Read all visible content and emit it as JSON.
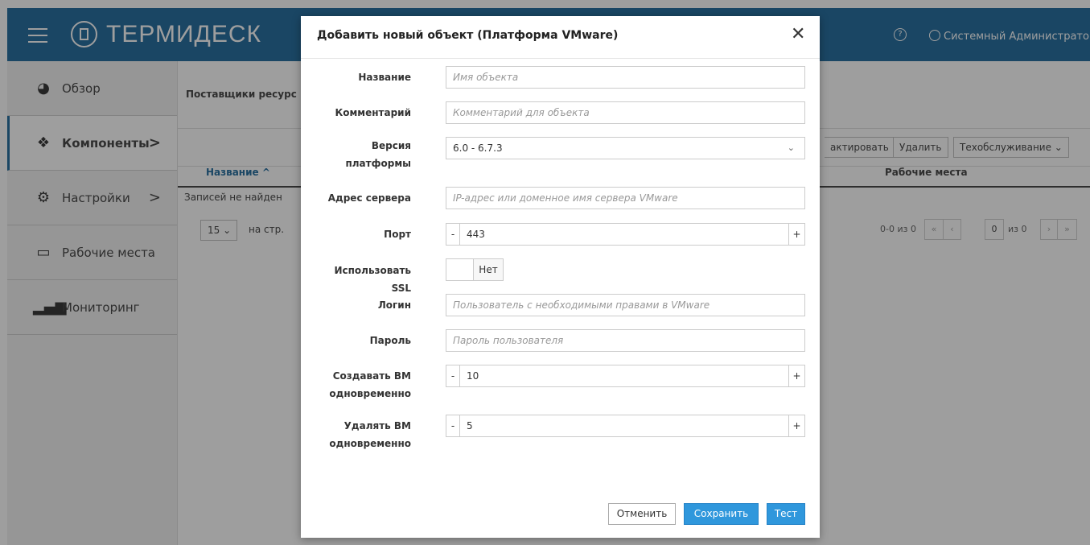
{
  "app": {
    "logo_text": "ТЕРМИДЕСК",
    "help_icon": "?",
    "user_label": "Системный Администратор"
  },
  "sidebar": {
    "items": [
      {
        "label": "Обзор",
        "icon": "dashboard-icon",
        "arrow": ""
      },
      {
        "label": "Компоненты",
        "icon": "cubes-icon",
        "arrow": ">"
      },
      {
        "label": "Настройки",
        "icon": "gears-icon",
        "arrow": ">"
      },
      {
        "label": "Рабочие места",
        "icon": "desktop-icon",
        "arrow": ""
      },
      {
        "label": "Мониторинг",
        "icon": "bars-icon",
        "arrow": ""
      }
    ]
  },
  "main": {
    "breadcrumb": "Поставщики ресурс",
    "toolbar": {
      "edit_label": "актировать",
      "delete_label": "Удалить",
      "maintenance_label": "Техобслуживание ⌄"
    },
    "table": {
      "columns": [
        "Название ^",
        "Рабочие места"
      ],
      "empty_text": "Записей не найден"
    },
    "pagination": {
      "page_size": "15 ⌄",
      "per_page_label": "на стр.",
      "range_text": "0-0 из 0",
      "first": "«",
      "prev": "‹",
      "page_input": "0",
      "of_text": "из 0",
      "next": "›",
      "last": "»"
    }
  },
  "modal": {
    "title": "Добавить новый объект (Платформа VMware)",
    "close": "✕",
    "fields": {
      "name": {
        "label": "Название",
        "placeholder": "Имя объекта"
      },
      "comment": {
        "label": "Комментарий",
        "placeholder": "Комментарий для объекта"
      },
      "version": {
        "label": "Версия платформы",
        "value": "6.0 - 6.7.3"
      },
      "server": {
        "label": "Адрес сервера",
        "placeholder": "IP-адрес или доменное имя сервера VMware"
      },
      "port": {
        "label": "Порт",
        "value": "443"
      },
      "ssl": {
        "label": "Использовать SSL",
        "value": "Нет"
      },
      "login": {
        "label": "Логин",
        "placeholder": "Пользователь с необходимыми правами в VMware"
      },
      "password": {
        "label": "Пароль",
        "placeholder": "Пароль пользователя"
      },
      "create_vm": {
        "label": "Создавать ВМ одновременно",
        "value": "10"
      },
      "delete_vm": {
        "label": "Удалять ВМ одновременно",
        "value": "5"
      }
    },
    "stepper": {
      "minus": "-",
      "plus": "+"
    },
    "buttons": {
      "cancel": "Отменить",
      "save": "Сохранить",
      "test": "Тест"
    }
  }
}
